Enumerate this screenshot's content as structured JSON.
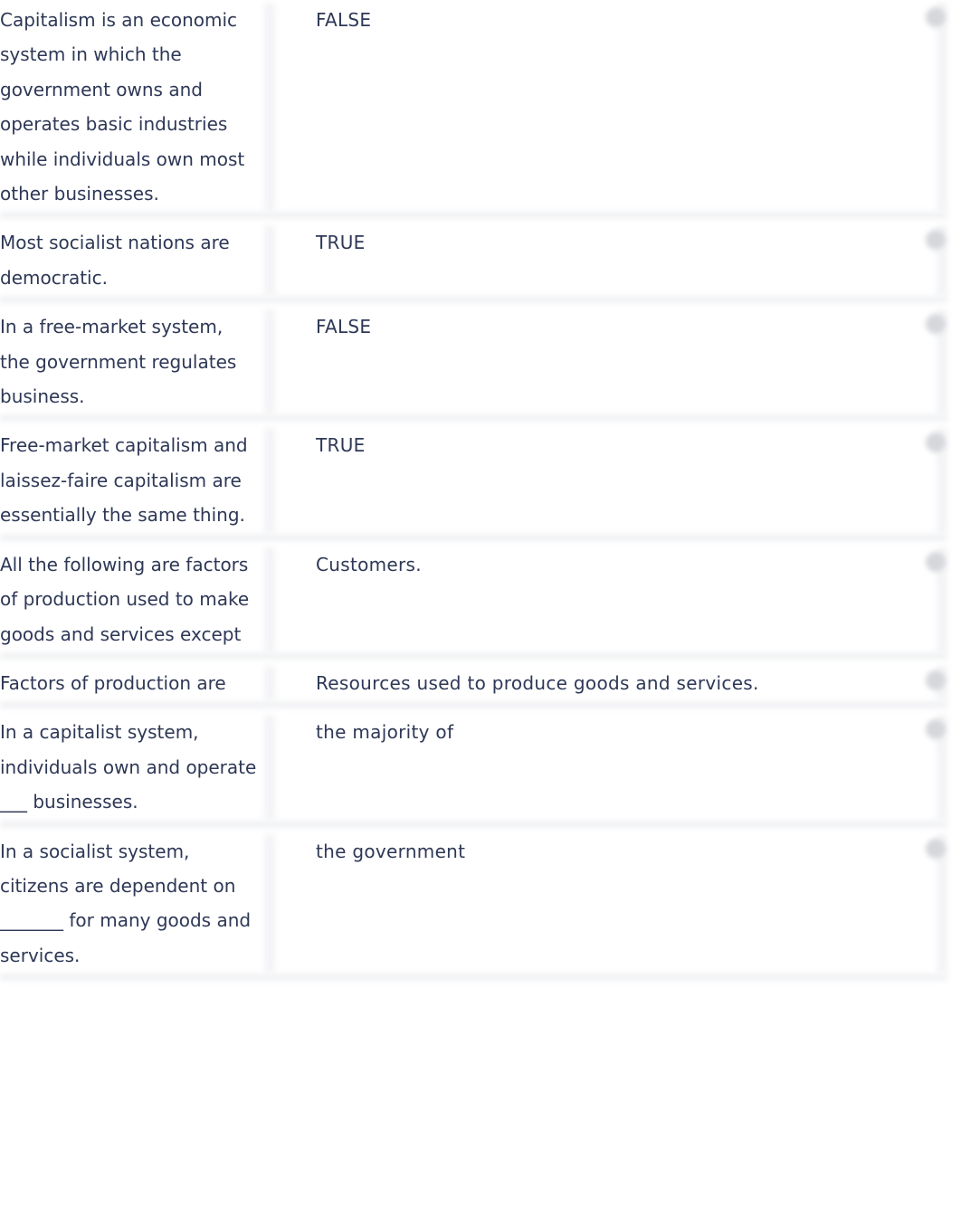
{
  "cards": [
    {
      "term": "Capitalism is an economic system in which the government owns and operates basic industries while individuals own most other businesses.",
      "definition": "FALSE"
    },
    {
      "term": "Most socialist nations are democratic.",
      "definition": "TRUE"
    },
    {
      "term": "In a free-market system, the government regulates business.",
      "definition": "FALSE"
    },
    {
      "term": "Free-market capitalism and laissez-faire capitalism are essentially the same thing.",
      "definition": "TRUE"
    },
    {
      "term": "All the following are factors of production used to make goods and services except",
      "definition": "Customers."
    },
    {
      "term": "Factors of production are",
      "definition": "Resources used to produce goods and services."
    },
    {
      "term": "In a capitalist system, individuals own and operate ___ businesses.",
      "definition": "the majority of"
    },
    {
      "term": "In a socialist system, citizens are dependent on _______ for many goods and services.",
      "definition": "the government"
    }
  ],
  "icons": {
    "row_action": "star-icon"
  }
}
